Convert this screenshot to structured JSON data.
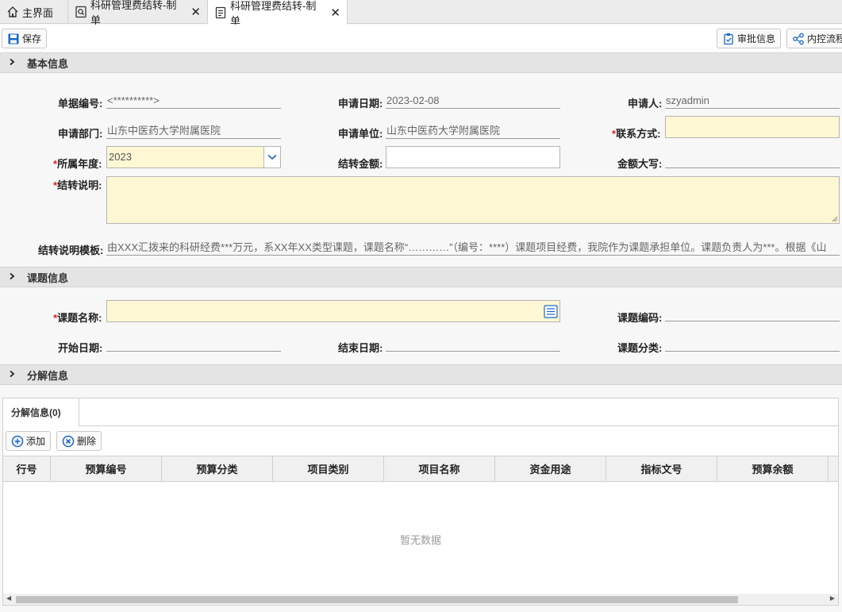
{
  "tabs": [
    {
      "label": "主界面",
      "icon": "home-icon"
    },
    {
      "label": "科研管理费结转-制单",
      "icon": "search-doc-icon"
    },
    {
      "label": "科研管理费结转-制单",
      "icon": "document-icon"
    }
  ],
  "toolbar": {
    "save_label": "保存",
    "approval_label": "审批信息",
    "workflow_label": "内控流程"
  },
  "sections": {
    "basic": "基本信息",
    "project": "课题信息",
    "split": "分解信息"
  },
  "basic": {
    "doc_no_label": "单据编号:",
    "doc_no_value": "<**********>",
    "apply_date_label": "申请日期:",
    "apply_date_value": "2023-02-08",
    "applicant_label": "申请人:",
    "applicant_value": "szyadmin",
    "dept_label": "申请部门:",
    "dept_value": "山东中医药大学附属医院",
    "unit_label": "申请单位:",
    "unit_value": "山东中医药大学附属医院",
    "contact_label": "联系方式:",
    "year_label": "所属年度:",
    "year_value": "2023",
    "amount_label": "结转金额:",
    "amount_upper_label": "金额大写:",
    "desc_label": "结转说明:",
    "template_label": "结转说明模板:",
    "template_value": "由XXX汇拨来的科研经费***万元，系XX年XX类型课题，课题名称“…………”（编号：****）课题项目经费，我院作为课题承担单位。课题负责人为***。根据《山"
  },
  "project": {
    "name_label": "课题名称:",
    "code_label": "课题编码:",
    "start_label": "开始日期:",
    "end_label": "结束日期:",
    "category_label": "课题分类:"
  },
  "split": {
    "tab_label": "分解信息(0)",
    "add_label": "添加",
    "delete_label": "删除",
    "columns": [
      "行号",
      "预算编号",
      "预算分类",
      "项目类别",
      "项目名称",
      "资金用途",
      "指标文号",
      "预算余额"
    ],
    "empty_text": "暂无数据"
  },
  "required_mark": "*"
}
